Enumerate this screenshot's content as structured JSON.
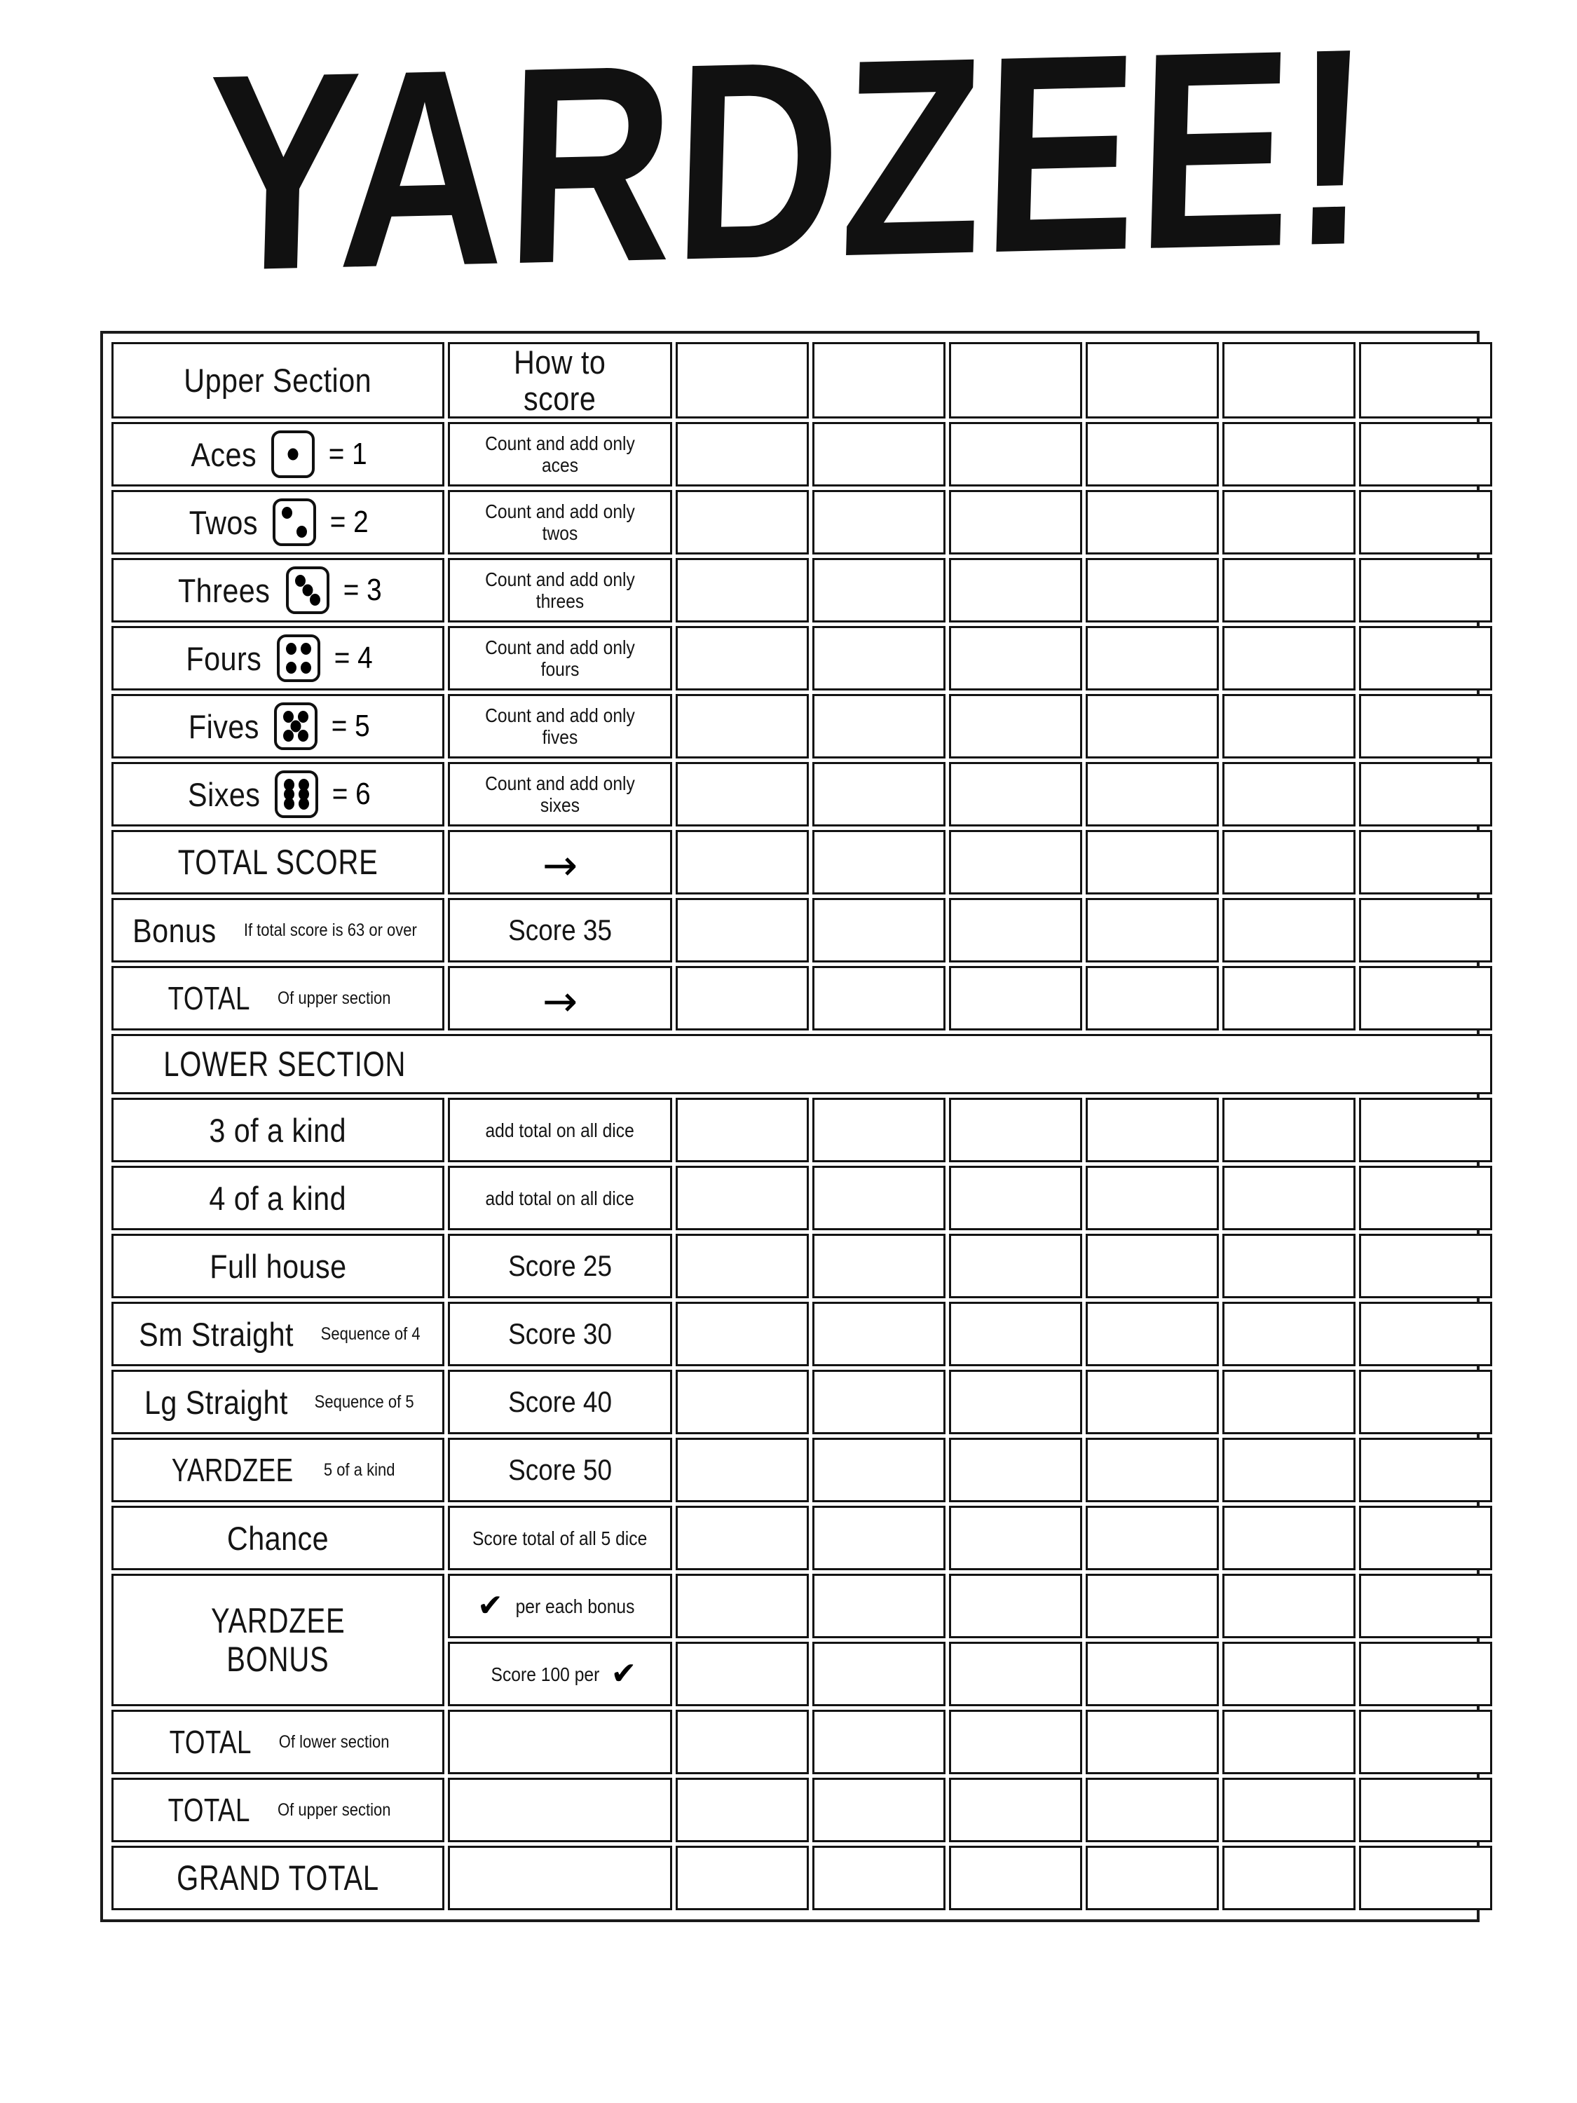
{
  "title": "YARDZEE!",
  "columns": {
    "label_header": "Upper Section",
    "how_header": "How to score",
    "score_column_count": 6
  },
  "headers": {
    "upper_section": "Upper Section",
    "how_to_score": "How to score",
    "lower_section": "LOWER SECTION"
  },
  "upper_rows": [
    {
      "label": "Aces",
      "die": 1,
      "equals": "= 1",
      "how": "Count and add only aces"
    },
    {
      "label": "Twos",
      "die": 2,
      "equals": "= 2",
      "how": "Count and add only twos"
    },
    {
      "label": "Threes",
      "die": 3,
      "equals": "= 3",
      "how": "Count and add only threes"
    },
    {
      "label": "Fours",
      "die": 4,
      "equals": "= 4",
      "how": "Count and add only fours"
    },
    {
      "label": "Fives",
      "die": 5,
      "equals": "= 5",
      "how": "Count and add only fives"
    },
    {
      "label": "Sixes",
      "die": 6,
      "equals": "= 6",
      "how": "Count and add only sixes"
    }
  ],
  "upper_totals": [
    {
      "label": "TOTAL SCORE",
      "annot": "",
      "how": "→"
    },
    {
      "label": "Bonus",
      "annot": "If total score is 63 or over",
      "how": "Score 35"
    },
    {
      "label": "TOTAL",
      "annot": "Of upper section",
      "how": "→"
    }
  ],
  "lower_rows": [
    {
      "label": "3 of a kind",
      "annot": "",
      "how": "add total on all dice"
    },
    {
      "label": "4 of a kind",
      "annot": "",
      "how": "add total on all dice"
    },
    {
      "label": "Full house",
      "annot": "",
      "how": "Score 25"
    },
    {
      "label": "Sm Straight",
      "annot": "Sequence of 4",
      "how": "Score 30"
    },
    {
      "label": "Lg Straight",
      "annot": "Sequence of 5",
      "how": "Score 40"
    },
    {
      "label": "YARDZEE",
      "annot": "5 of a kind",
      "how": "Score 50"
    },
    {
      "label": "Chance",
      "annot": "",
      "how": "Score total of all 5 dice"
    }
  ],
  "yardzee_bonus": {
    "label_line1": "YARDZEE",
    "label_line2": "BONUS",
    "how_line1": "per each bonus",
    "how_line1_tick": "✔",
    "how_line2": "Score 100 per",
    "how_line2_tick": "✔"
  },
  "final_totals": [
    {
      "label": "TOTAL",
      "annot": "Of lower section"
    },
    {
      "label": "TOTAL",
      "annot": "Of upper section"
    },
    {
      "label": "GRAND  TOTAL",
      "annot": ""
    }
  ],
  "dice_pip_layouts": {
    "1": [
      "center"
    ],
    "2": [
      "tl",
      "br"
    ],
    "3": [
      "tl",
      "center",
      "br"
    ],
    "4": [
      "tl",
      "tr",
      "bl",
      "br"
    ],
    "5": [
      "tl",
      "tr",
      "center",
      "bl",
      "br"
    ],
    "6": [
      "tl",
      "tr",
      "ml",
      "mr",
      "bl",
      "br"
    ]
  },
  "colors": {
    "ink": "#131313",
    "paper": "#ffffff"
  }
}
